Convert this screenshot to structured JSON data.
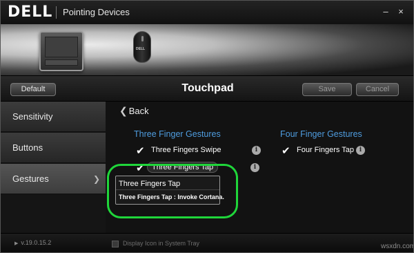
{
  "window": {
    "brand": "DELL",
    "title": "Pointing Devices",
    "minimize_glyph": "–",
    "close_glyph": "×"
  },
  "banner": {
    "devices": [
      {
        "name": "touchpad",
        "icon": "touchpad-icon"
      },
      {
        "name": "mouse",
        "icon": "mouse-icon",
        "brand_text": "DELL"
      }
    ]
  },
  "toolbar": {
    "default_label": "Default",
    "title": "Touchpad",
    "save_label": "Save",
    "cancel_label": "Cancel"
  },
  "sidebar": {
    "items": [
      {
        "label": "Sensitivity"
      },
      {
        "label": "Buttons"
      },
      {
        "label": "Gestures",
        "selected": true,
        "chevron": "❯"
      }
    ]
  },
  "content": {
    "back_label": "Back",
    "back_icon": "❮",
    "three_finger": {
      "heading": "Three Finger Gestures",
      "options": [
        {
          "label": "Three Fingers Swipe",
          "checked": true
        },
        {
          "label": "Three Fingers Tap",
          "checked": true
        }
      ]
    },
    "four_finger": {
      "heading": "Four Finger Gestures",
      "options": [
        {
          "label": "Four Fingers Tap",
          "checked": true
        }
      ]
    },
    "check_glyph": "✔",
    "info_glyph": "i",
    "tooltip": {
      "title": "Three Fingers Tap",
      "body": "Three Fingers Tap : Invoke Cortana."
    }
  },
  "footer": {
    "version": "v.19.0.15.2",
    "version_glyph": "▶",
    "tray_label": "Display Icon in System Tray",
    "tray_checked": false,
    "watermark": "wsxdn.com"
  },
  "colors": {
    "accent": "#4f9de0",
    "highlight": "#1fd63a",
    "background": "#161616"
  }
}
